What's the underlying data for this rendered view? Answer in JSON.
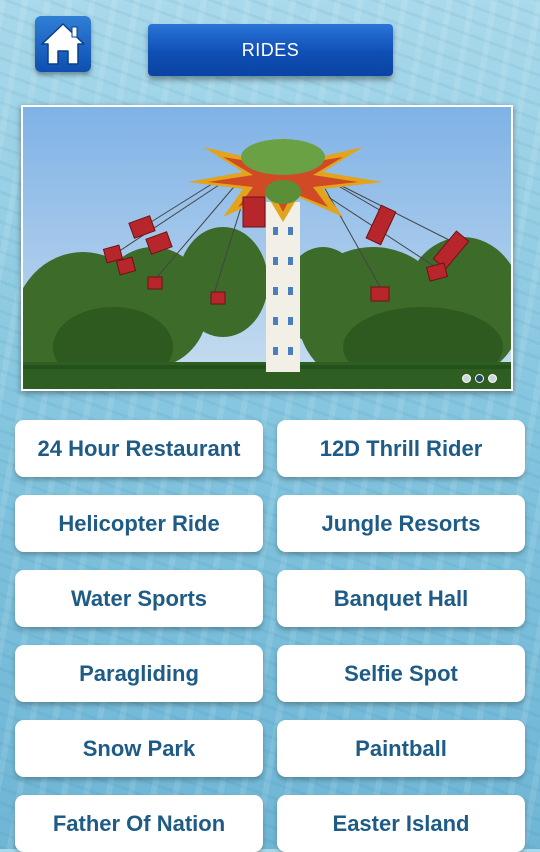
{
  "header": {
    "home_icon": "home-icon",
    "title": "RIDES"
  },
  "banner": {
    "slide_count": 3,
    "active_slide": 2
  },
  "rides": [
    "24 Hour Restaurant",
    "12D Thrill Rider",
    "Helicopter Ride",
    "Jungle Resorts",
    "Water Sports",
    "Banquet Hall",
    "Paragliding",
    "Selfie Spot",
    "Snow Park",
    "Paintball",
    "Father Of Nation",
    "Easter Island"
  ],
  "colors": {
    "header_blue": "#0f4fb5",
    "tile_text": "#1e5b86",
    "tile_bg": "#ffffff"
  }
}
